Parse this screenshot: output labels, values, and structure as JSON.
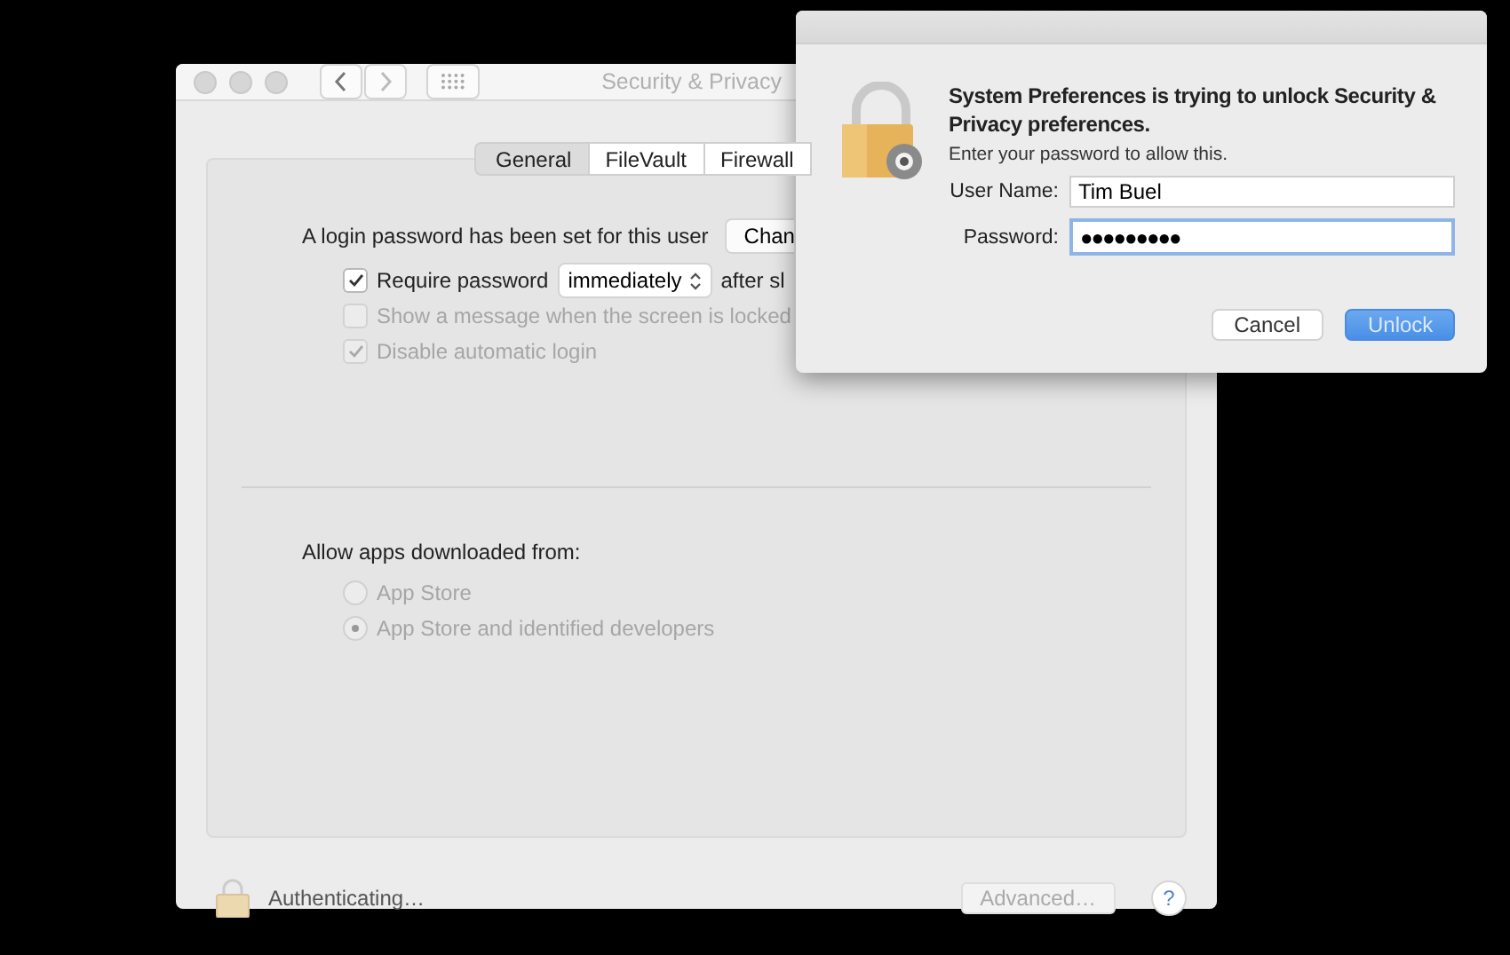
{
  "main_window": {
    "title": "Security & Privacy",
    "tabs": [
      {
        "label": "General",
        "selected": true
      },
      {
        "label": "FileVault",
        "selected": false
      },
      {
        "label": "Firewall",
        "selected": false
      }
    ],
    "login_password": {
      "text": "A login password has been set for this user",
      "button": "Chan"
    },
    "require_password": {
      "label": "Require password",
      "checked": true,
      "popup": "immediately",
      "after": "after sl"
    },
    "options": [
      {
        "label": "Show a message when the screen is locked",
        "checked": false,
        "disabled": true
      },
      {
        "label": "Disable automatic login",
        "checked": true,
        "disabled": true
      }
    ],
    "allow_apps": {
      "heading": "Allow apps downloaded from:",
      "choices": [
        {
          "label": "App Store",
          "selected": false,
          "disabled": true
        },
        {
          "label": "App Store and identified developers",
          "selected": true,
          "disabled": true
        }
      ]
    },
    "footer": {
      "status": "Authenticating…",
      "advanced_button": {
        "label": "Advanced…",
        "disabled": true
      },
      "help": "?"
    }
  },
  "dialog": {
    "title": "System Preferences is trying to unlock Security & Privacy preferences.",
    "message": "Enter your password to allow this.",
    "fields": [
      {
        "label": "User Name:",
        "value": "Tim Buel",
        "focused": false
      },
      {
        "label": "Password:",
        "value": "●●●●●●●●●",
        "focused": true
      }
    ],
    "buttons": [
      {
        "label": "Cancel",
        "kind": "secondary"
      },
      {
        "label": "Unlock",
        "kind": "primary"
      }
    ]
  }
}
